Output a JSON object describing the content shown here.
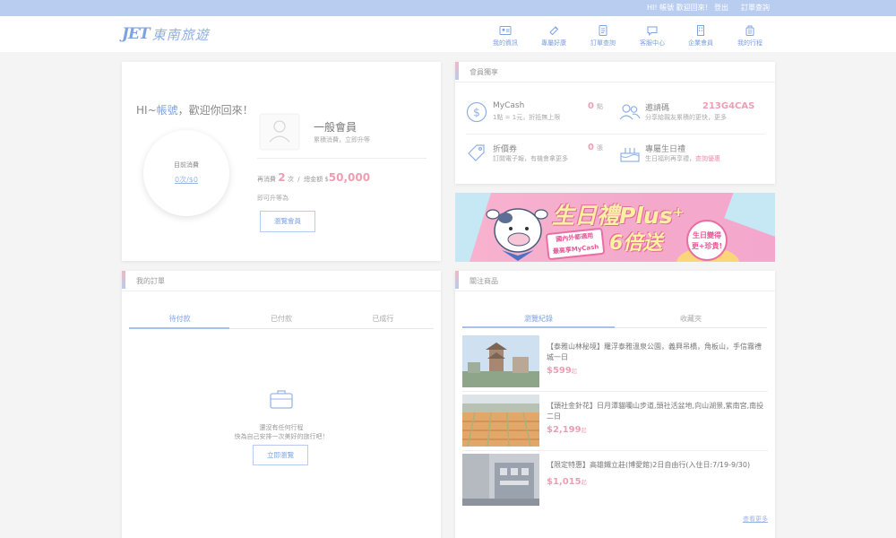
{
  "topbar": {
    "greeting": "HI! 帳號 歡迎回來！",
    "logout": "登出",
    "order_query": "訂單查詢"
  },
  "brand": {
    "logo_en": "JET",
    "logo_cn": "東南旅遊",
    "accent": "#7fa3df",
    "pink": "#ec9fb2"
  },
  "nav": [
    {
      "label": "我的資訊",
      "icon": "profile-card-icon"
    },
    {
      "label": "專屬好康",
      "icon": "ticket-icon"
    },
    {
      "label": "訂單查詢",
      "icon": "document-icon"
    },
    {
      "label": "客服中心",
      "icon": "chat-icon"
    },
    {
      "label": "企業會員",
      "icon": "building-icon"
    },
    {
      "label": "我的行程",
      "icon": "luggage-icon"
    }
  ],
  "welcome": {
    "hi": "HI~",
    "name": "帳號",
    "rest": "，歡迎你回來！",
    "circle_label": "目前消費",
    "circle_value": "0次/$0",
    "level_name": "一般會員",
    "level_sub": "累積消費，立即升等",
    "stat_prefix": "再消費",
    "stat_times": "2",
    "stat_times_unit": "次",
    "stat_sep": "/",
    "stat_amount_label": "總金額",
    "stat_currency": "$",
    "stat_amount": "50,000",
    "hint": "即可升等為",
    "button": "瀏覽會員"
  },
  "benefits": {
    "title": "會員獨享",
    "mycash_title": "MyCash",
    "mycash_sub": "1點 = 1元，折抵無上限",
    "mycash_value": "0",
    "mycash_unit": "點",
    "invite_title": "邀請碼",
    "invite_sub": "分享給親友累積的更快，更多",
    "invite_code": "213G4CAS",
    "coupon_title": "折價券",
    "coupon_sub": "訂閱電子報，有機會拿更多",
    "coupon_value": "0",
    "coupon_unit": "張",
    "birthday_title": "專屬生日禮",
    "birthday_sub": "生日福利再享禮，",
    "birthday_link": "查詢優惠"
  },
  "banner": {
    "title": "生日禮Plus⁺",
    "note_line1": "國內外都適用",
    "note_line2": "最高享MyCash",
    "multiplier": "6倍送",
    "badge_line1": "生日變得",
    "badge_line2": "更+珍貴!"
  },
  "orders": {
    "title": "我的訂單",
    "tabs": [
      "待付款",
      "已付款",
      "已成行"
    ],
    "empty_line1": "還沒有任何行程",
    "empty_line2": "快為自己安排一次美好的旅行吧！",
    "button": "立即瀏覽"
  },
  "watch": {
    "title": "關注商品",
    "tabs": [
      "瀏覽紀錄",
      "收藏夾"
    ],
    "items": [
      {
        "title": "【泰雅山林秘境】羅浮泰雅溫泉公園，義興吊橋，角板山，手信霧禮城一日",
        "price": "$599",
        "unit": "起"
      },
      {
        "title": "【頭社金針花】日月潭貓囒山步道,頭社活盆地,向山湖景,紫南宮,南投二日",
        "price": "$2,199",
        "unit": "起"
      },
      {
        "title": "【限定特惠】高雄鐵立莊(博愛館)2日自由行(入住日:7/19-9/30)",
        "price": "$1,015",
        "unit": "起"
      }
    ],
    "more": "查看更多"
  }
}
